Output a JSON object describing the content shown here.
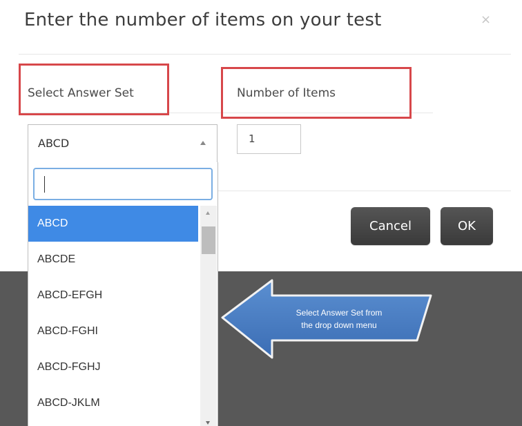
{
  "modal": {
    "title": "Enter the number of items on your test",
    "close_glyph": "×",
    "cancel_label": "Cancel",
    "ok_label": "OK"
  },
  "form": {
    "answer_set_label": "Select Answer Set",
    "number_label": "Number of Items",
    "answer_set_value": "ABCD",
    "number_value": "1"
  },
  "dropdown": {
    "search_value": "",
    "options": [
      "ABCD",
      "ABCDE",
      "ABCD-EFGH",
      "ABCD-FGHI",
      "ABCD-FGHJ",
      "ABCD-JKLM"
    ],
    "selected": "ABCD"
  },
  "callout": {
    "line1": "Select Answer Set from",
    "line2": "the drop down menu"
  },
  "colors": {
    "highlight_box": "#d7474a",
    "selected_option": "#3f8ae5",
    "callout_arrow": "#4a7dc0",
    "button": "#444444"
  }
}
